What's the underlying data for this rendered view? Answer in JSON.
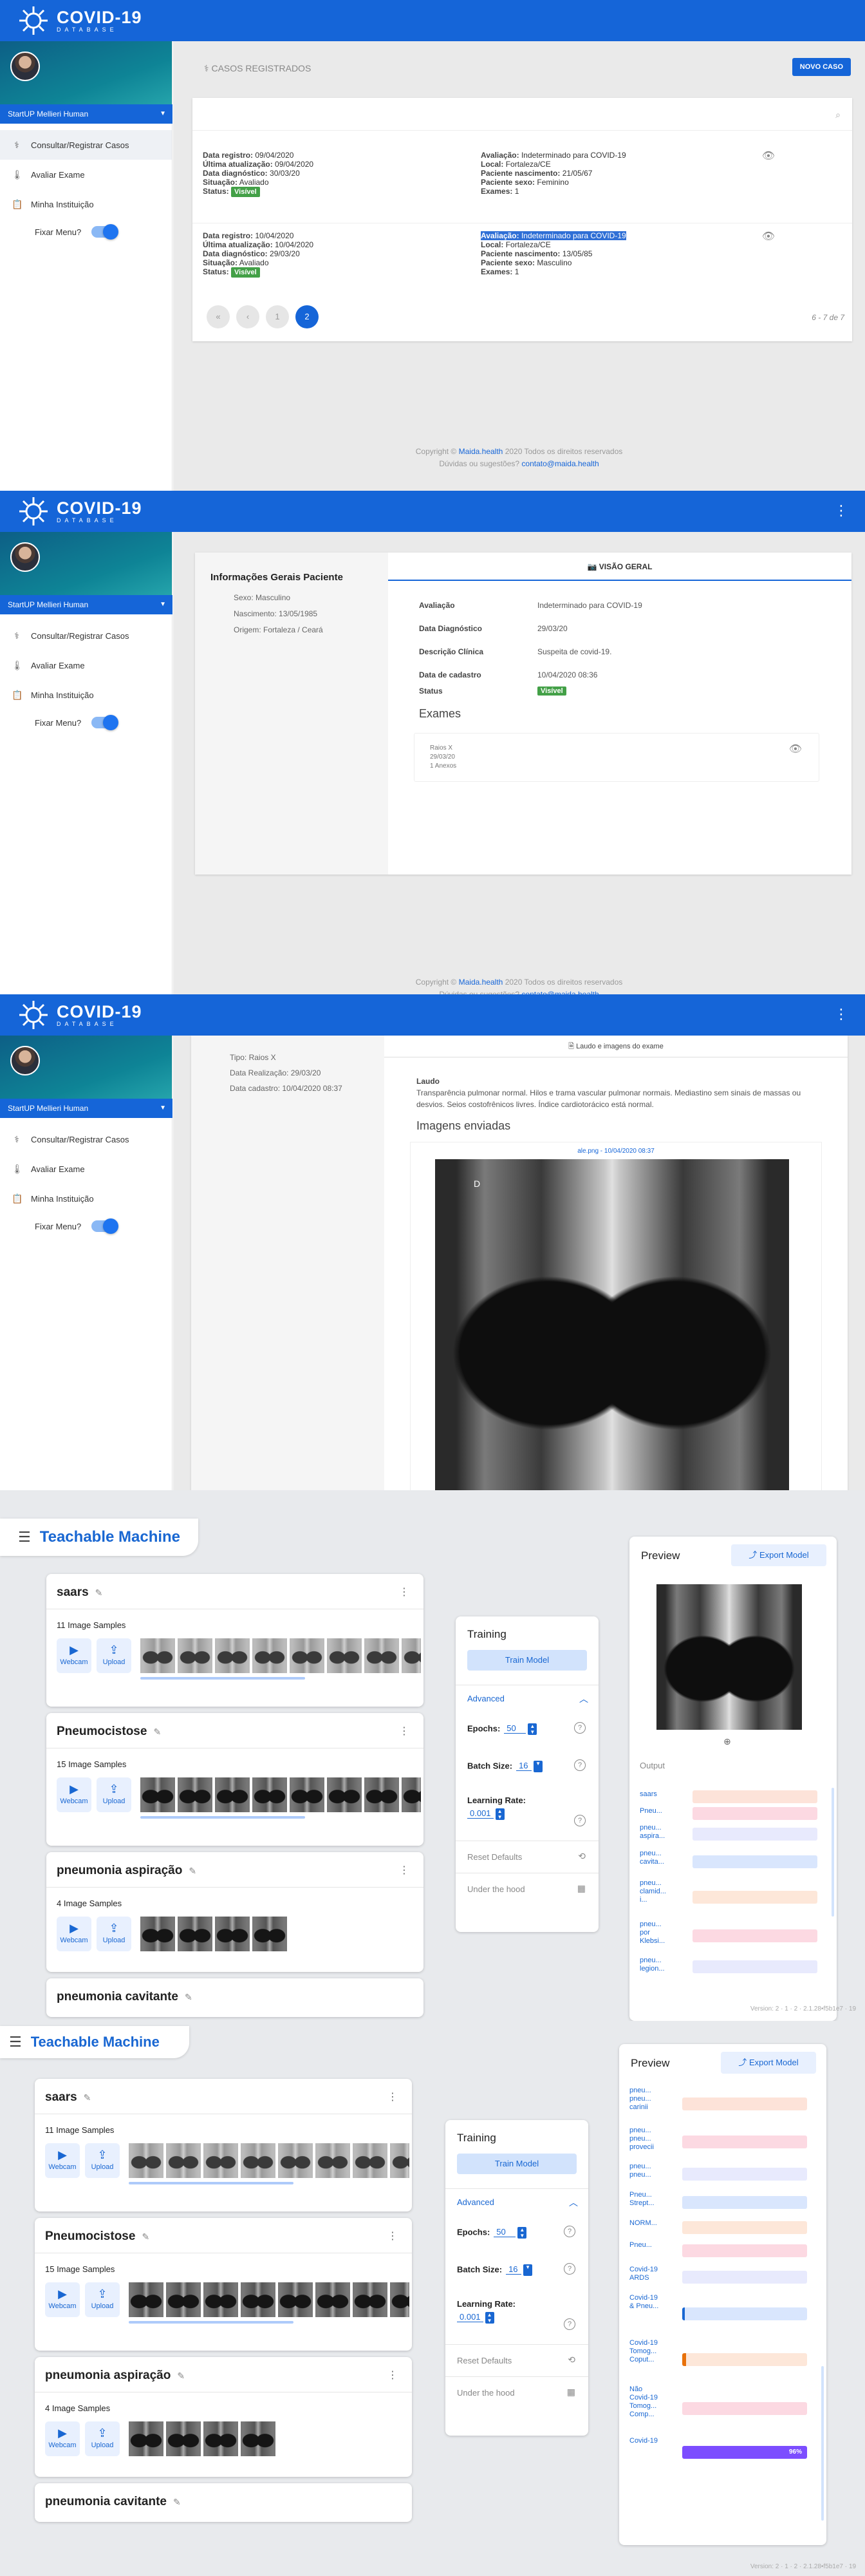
{
  "app": {
    "title": "COVID-19",
    "subtitle": "DATABASE"
  },
  "sidebar": {
    "user": "StartUP Mellieri Human",
    "items": [
      {
        "label": "Consultar/Registrar Casos"
      },
      {
        "label": "Avaliar Exame"
      },
      {
        "label": "Minha Instituição"
      }
    ],
    "fixar_label": "Fixar Menu?"
  },
  "casos": {
    "title": "CASOS REGISTRADOS",
    "novo_caso": "NOVO CASO",
    "records": [
      {
        "left": [
          [
            "Data registro:",
            "09/04/2020"
          ],
          [
            "Última atualização:",
            "09/04/2020"
          ],
          [
            "Data diagnóstico:",
            "30/03/20"
          ],
          [
            "Situação:",
            "Avaliado"
          ]
        ],
        "status_label": "Status:",
        "status": "Visível",
        "right": [
          [
            "Avaliação:",
            "Indeterminado para COVID-19"
          ],
          [
            "Local:",
            "Fortaleza/CE"
          ],
          [
            "Paciente nascimento:",
            "21/05/67"
          ],
          [
            "Paciente sexo:",
            "Feminino"
          ],
          [
            "Exames:",
            "1"
          ]
        ]
      },
      {
        "left": [
          [
            "Data registro:",
            "10/04/2020"
          ],
          [
            "Última atualização:",
            "10/04/2020"
          ],
          [
            "Data diagnóstico:",
            "29/03/20"
          ],
          [
            "Situação:",
            "Avaliado"
          ]
        ],
        "status_label": "Status:",
        "status": "Visível",
        "right": [
          [
            "Avaliação:",
            "Indeterminado para COVID-19"
          ],
          [
            "Local:",
            "Fortaleza/CE"
          ],
          [
            "Paciente nascimento:",
            "13/05/85"
          ],
          [
            "Paciente sexo:",
            "Masculino"
          ],
          [
            "Exames:",
            "1"
          ]
        ]
      }
    ],
    "pagination": {
      "first": "«",
      "prev": "‹",
      "pages": [
        "1",
        "2"
      ],
      "info": "6 - 7 de 7"
    }
  },
  "footer": {
    "text1": "Copyright ©",
    "link1": "Maida.health",
    "text2": "2020 Todos os direitos reservados",
    "text3": "Dúvidas ou sugestões?",
    "link2": "contato@maida.health"
  },
  "paciente": {
    "title": "Informações Gerais Paciente",
    "rows": [
      "Sexo: Masculino",
      "Nascimento: 13/05/1985",
      "Origem: Fortaleza / Ceará"
    ],
    "tab": "VISÃO GERAL",
    "fields": [
      [
        "Avaliação",
        "Indeterminado para COVID-19"
      ],
      [
        "Data Diagnóstico",
        "29/03/20"
      ],
      [
        "Descrição Clínica",
        "Suspeita de covid-19."
      ],
      [
        "Data de cadastro",
        "10/04/2020 08:36"
      ]
    ],
    "status_label": "Status",
    "status": "Visível",
    "exames_title": "Exames",
    "exame": [
      "Raios X",
      "29/03/20",
      "1 Anexos"
    ]
  },
  "exame": {
    "rows": [
      "Tipo: Raios X",
      "Data Realização: 29/03/20",
      "Data cadastro: 10/04/2020 08:37"
    ],
    "tab": "Laudo e imagens do exame",
    "laudo_title": "Laudo",
    "laudo": "Transparência pulmonar normal. Hilos e trama vascular pulmonar normais. Mediastino sem sinais de massas ou desvios. Seios costofrênicos livres. Índice cardiotorácico está normal.",
    "imagens_title": "Imagens enviadas",
    "file": "ale.png - 10/04/2020 08:37",
    "marker": "D"
  },
  "tm": {
    "title": "Teachable Machine",
    "classes": [
      {
        "name": "saars",
        "samples": "11 Image Samples"
      },
      {
        "name": "Pneumocistose",
        "samples": "15 Image Samples"
      },
      {
        "name": "pneumonia aspiração",
        "samples": "4 Image Samples"
      },
      {
        "name": "pneumonia cavitante",
        "samples": ""
      }
    ],
    "webcam": "Webcam",
    "upload": "Upload",
    "training": {
      "title": "Training",
      "train_btn": "Train Model",
      "advanced": "Advanced",
      "epochs_label": "Epochs:",
      "epochs": "50",
      "batch_label": "Batch Size:",
      "batch": "16",
      "lr_label": "Learning Rate:",
      "lr": "0.001",
      "reset": "Reset Defaults",
      "hood": "Under the hood"
    },
    "preview": {
      "title": "Preview",
      "export": "Export Model",
      "output": "Output"
    },
    "outputs1": [
      "saars",
      "Pneu...",
      "pneu... aspira...",
      "pneu... cavita...",
      "pneu... clamid... i...",
      "pneu... por Klebsi...",
      "pneu... legion..."
    ],
    "outputs2": [
      "pneu... pneu... carinii",
      "pneu... pneu... provecii",
      "pneu... pneu...",
      "Pneu... Strept...",
      "NORM...",
      "Pneu...",
      "Covid-19 ARDS",
      "Covid-19 & Pneu...",
      "Covid-19 Tomog... Coput...",
      "Não Covid-19 Tomog... Comp...",
      "Covid-19"
    ],
    "last_pct": "96%",
    "version": "Version: 2 · 1 · 2 · 2.1.28•f5b1e7 · 19"
  },
  "colors": {
    "brand": "#1565d8",
    "tm_blue": "#1967d2",
    "green": "#43a047"
  }
}
